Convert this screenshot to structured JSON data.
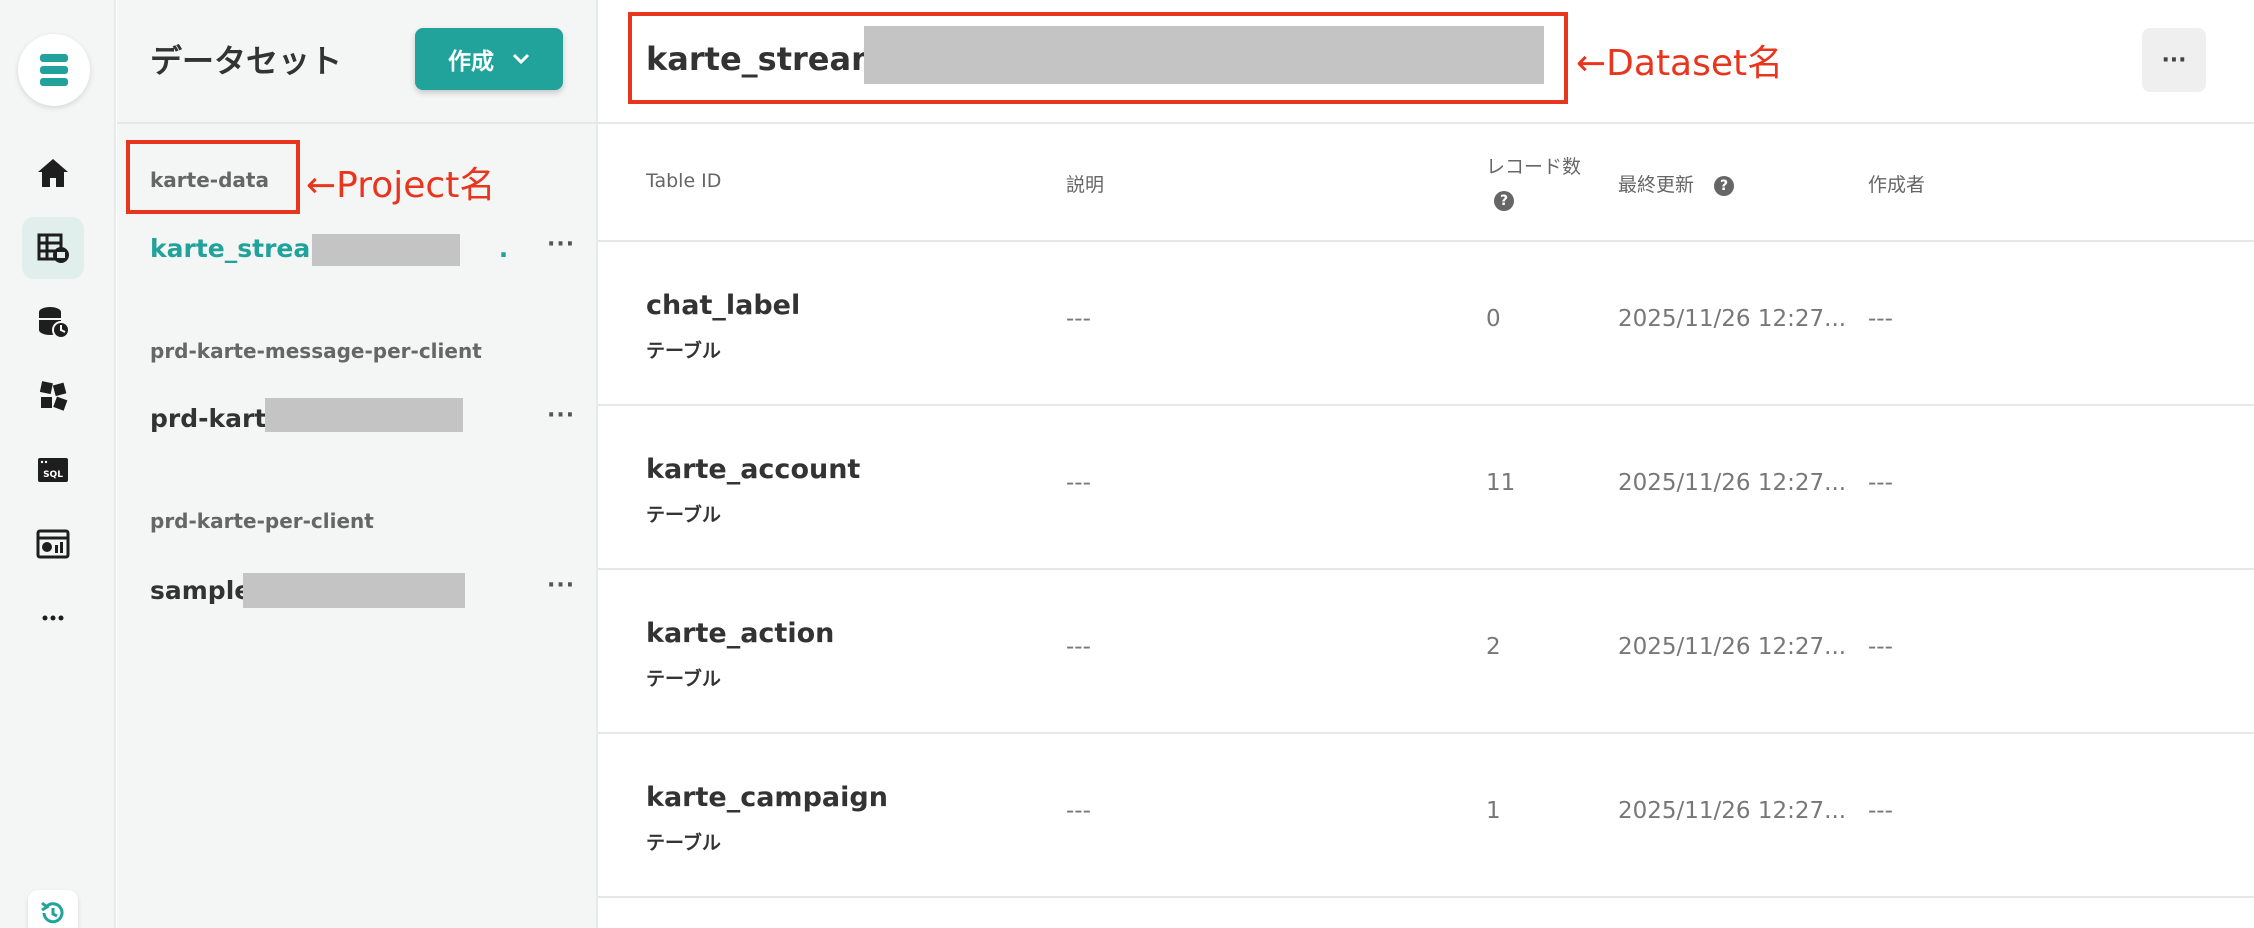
{
  "rail": {
    "icons": [
      "logo-icon",
      "home-icon",
      "dataset-icon",
      "datahub-icon",
      "blocks-icon",
      "sql-icon",
      "dashboard-icon",
      "more-icon",
      "history-icon"
    ]
  },
  "sidebar": {
    "title": "データセット",
    "create_label": "作成",
    "groups": [
      {
        "project": "karte-data",
        "datasets": [
          {
            "name": "karte_stream_",
            "suffix": "."
          }
        ]
      },
      {
        "project": "prd-karte-message-per-client",
        "datasets": [
          {
            "name": "prd-karte",
            "suffix": ""
          }
        ]
      },
      {
        "project": "prd-karte-per-client",
        "datasets": [
          {
            "name": "sample_",
            "suffix": ""
          }
        ]
      }
    ],
    "more_label": "···"
  },
  "main": {
    "title": "karte_stream_",
    "more_label": "···",
    "columns": {
      "table_id": "Table ID",
      "description": "説明",
      "records": "レコード数",
      "updated": "最終更新",
      "author": "作成者"
    },
    "help_label": "?",
    "rows": [
      {
        "id": "chat_label",
        "type": "テーブル",
        "description": "---",
        "records": "0",
        "updated": "2025/11/26 12:27...",
        "author": "---"
      },
      {
        "id": "karte_account",
        "type": "テーブル",
        "description": "---",
        "records": "11",
        "updated": "2025/11/26 12:27...",
        "author": "---"
      },
      {
        "id": "karte_action",
        "type": "テーブル",
        "description": "---",
        "records": "2",
        "updated": "2025/11/26 12:27...",
        "author": "---"
      },
      {
        "id": "karte_campaign",
        "type": "テーブル",
        "description": "---",
        "records": "1",
        "updated": "2025/11/26 12:27...",
        "author": "---"
      }
    ]
  },
  "annotations": {
    "dataset": "←Dataset名",
    "project": "←Project名"
  },
  "colors": {
    "accent": "#21a39b",
    "annotation": "#e8351e",
    "mask": "#c4c4c4"
  }
}
